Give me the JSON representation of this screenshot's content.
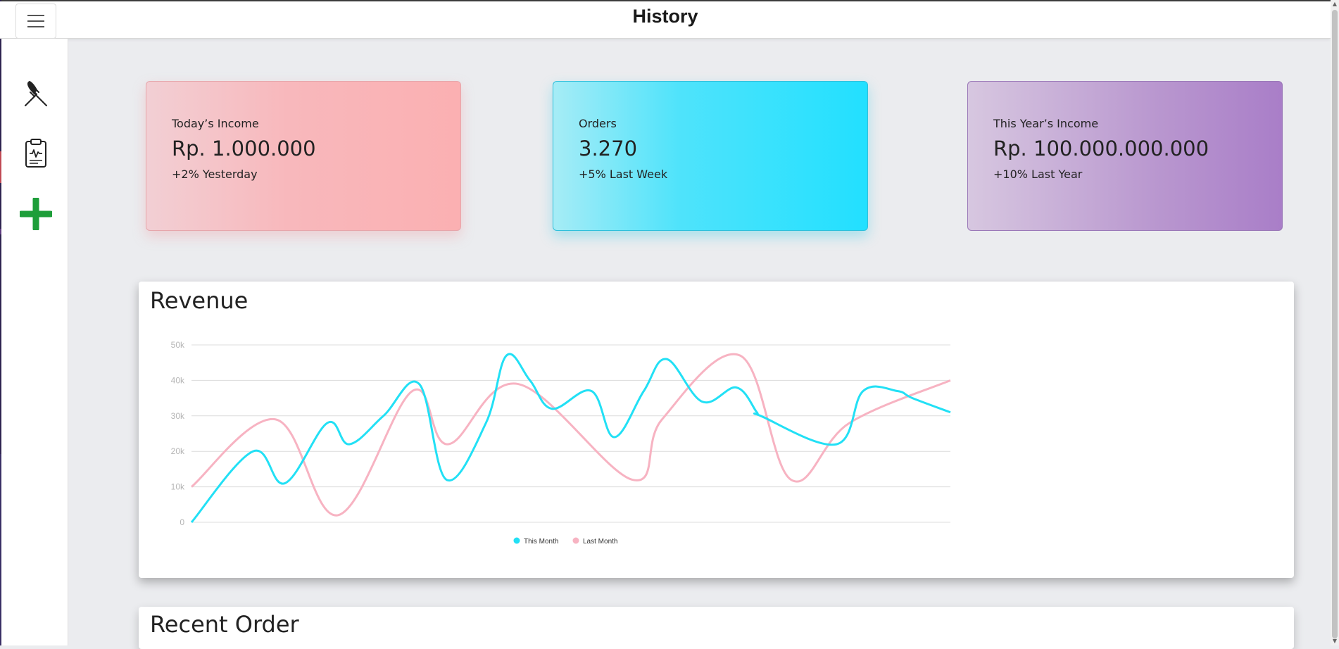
{
  "header": {
    "title": "History"
  },
  "sidebar": {
    "items": [
      {
        "icon": "fork-knife-icon"
      },
      {
        "icon": "clipboard-health-icon"
      },
      {
        "icon": "plus-icon",
        "color": "#1e9e3a"
      }
    ]
  },
  "cards": [
    {
      "label": "Today’s Income",
      "value": "Rp. 1.000.000",
      "sub": "+2% Yesterday",
      "color": "#fbb0b2"
    },
    {
      "label": "Orders",
      "value": "3.270",
      "sub": "+5% Last Week",
      "color": "#22e0ff"
    },
    {
      "label": "This Year’s Income",
      "value": "Rp. 100.000.000.000",
      "sub": "+10% Last Year",
      "color": "#a97ec8"
    }
  ],
  "revenue": {
    "title": "Revenue"
  },
  "recent": {
    "title": "Recent Order"
  },
  "chart_data": {
    "type": "line",
    "title": "",
    "xlabel": "",
    "ylabel": "",
    "ylim": [
      0,
      50000
    ],
    "y_ticks": [
      0,
      10000,
      20000,
      30000,
      40000,
      50000
    ],
    "y_tick_labels": [
      "0",
      "10k",
      "20k",
      "30k",
      "40k",
      "50k"
    ],
    "grid": true,
    "legend": "bottom-center",
    "series": [
      {
        "name": "This Month",
        "color": "#22e0f5",
        "x": [
          0,
          8.1,
          12.3,
          17.9,
          20.8,
          25.3,
          30,
          33.6,
          38.8,
          41.5,
          44.6,
          47.5,
          52.7,
          55.7,
          59.6,
          62.6,
          67.3,
          71.8,
          74.5,
          75,
          85,
          88.5,
          93,
          95,
          100
        ],
        "values": [
          0,
          20000,
          11000,
          28000,
          22000,
          30000,
          39000,
          12000,
          28000,
          47000,
          40000,
          32000,
          37000,
          24000,
          37000,
          46000,
          34000,
          38000,
          31000,
          30000,
          22000,
          37000,
          37000,
          35000,
          31000
        ]
      },
      {
        "name": "Last Month",
        "color": "#f7b3c2",
        "x": [
          0,
          11.1,
          19.3,
          29.1,
          33.8,
          43,
          58.1,
          62,
          72.3,
          79,
          86.7,
          100
        ],
        "values": [
          10000,
          29000,
          2000,
          37000,
          22000,
          39000,
          12000,
          29000,
          47000,
          12000,
          28000,
          40000
        ]
      }
    ]
  }
}
